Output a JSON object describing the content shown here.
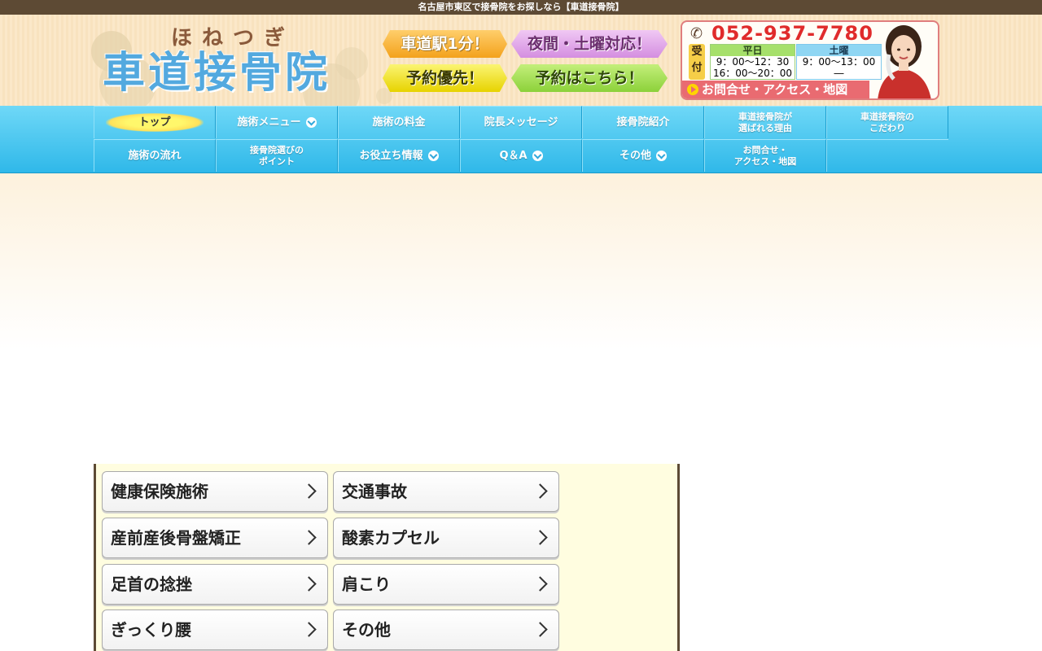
{
  "topbar": {
    "text": "名古屋市東区で接骨院をお探しなら【車道接骨院】"
  },
  "logo": {
    "furigana": "ほねつぎ",
    "name": "車道接骨院"
  },
  "badges": {
    "station": "車道駅1分！",
    "night": "夜間・土曜対応！",
    "priority": "予約優先！",
    "reserve": "予約はこちら！"
  },
  "contact": {
    "phone": "052-937-7780",
    "uketsuke": "受付",
    "weekday": {
      "label": "平日",
      "line1": "9：00～12：30",
      "line2": "16：00～20：00"
    },
    "saturday": {
      "label": "土曜",
      "line1": "9：00～13：00",
      "line2": "―"
    },
    "link": "お問合せ・アクセス・地図"
  },
  "nav": {
    "row1": [
      "トップ",
      "施術メニュー",
      "施術の料金",
      "院長メッセージ",
      "接骨院紹介",
      "車道接骨院が\n選ばれる理由",
      "車道接骨院の\nこだわり"
    ],
    "row2": [
      "施術の流れ",
      "接骨院選びの\nポイント",
      "お役立ち情報",
      "Q＆A",
      "その他",
      "お問合せ・\nアクセス・地図"
    ]
  },
  "menu": {
    "items": [
      "健康保険施術",
      "交通事故",
      "産前産後骨盤矯正",
      "酸素カプセル",
      "足首の捻挫",
      "肩こり",
      "ぎっくり腰",
      "その他"
    ]
  },
  "colors": {
    "accent_blue": "#2fb8e9",
    "brand_brown": "#5d4a34",
    "phone_red": "#e02b2b"
  }
}
